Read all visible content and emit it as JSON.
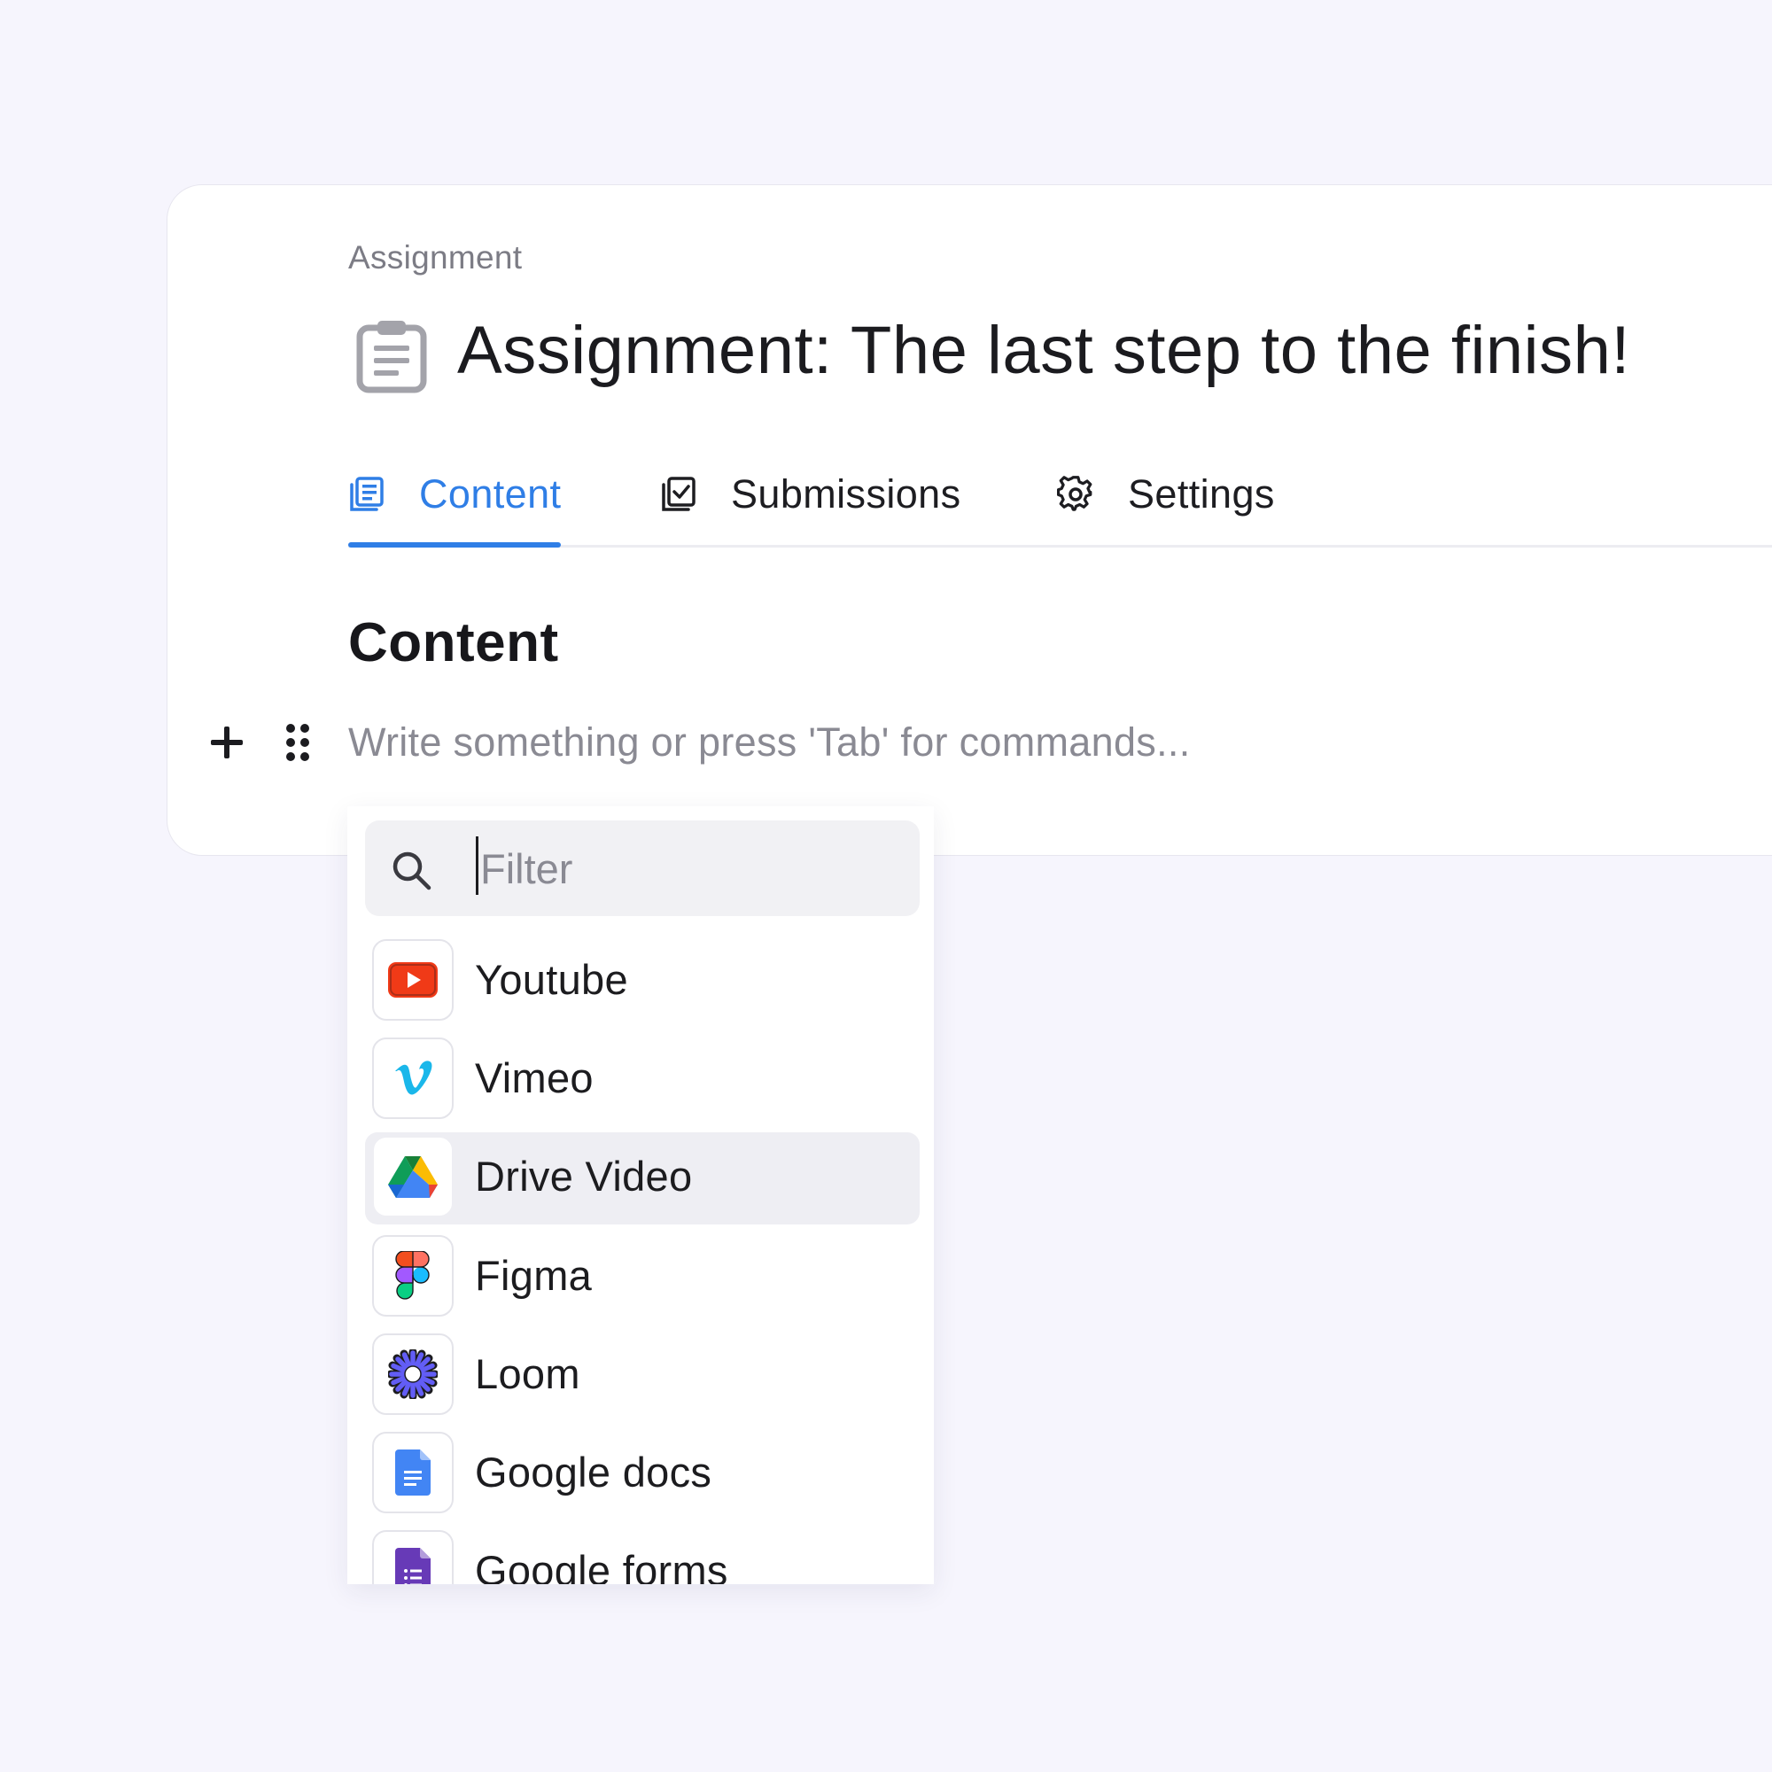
{
  "breadcrumb": "Assignment",
  "page_title": "Assignment: The last step to the finish!",
  "tabs": [
    {
      "label": "Content",
      "active": true
    },
    {
      "label": "Submissions",
      "active": false
    },
    {
      "label": "Settings",
      "active": false
    }
  ],
  "section_heading": "Content",
  "editor": {
    "placeholder": "Write something or press 'Tab' for commands..."
  },
  "command_menu": {
    "filter_placeholder": "Filter",
    "filter_value": "",
    "items": [
      {
        "label": "Youtube",
        "icon": "youtube-icon",
        "selected": false
      },
      {
        "label": "Vimeo",
        "icon": "vimeo-icon",
        "selected": false
      },
      {
        "label": "Drive Video",
        "icon": "google-drive-icon",
        "selected": true
      },
      {
        "label": "Figma",
        "icon": "figma-icon",
        "selected": false
      },
      {
        "label": "Loom",
        "icon": "loom-icon",
        "selected": false
      },
      {
        "label": "Google docs",
        "icon": "google-docs-icon",
        "selected": false
      },
      {
        "label": "Google forms",
        "icon": "google-forms-icon",
        "selected": false
      }
    ]
  },
  "colors": {
    "accent": "#2f7ee6",
    "background": "#f6f5fd",
    "selected_item": "#eeeef3"
  }
}
